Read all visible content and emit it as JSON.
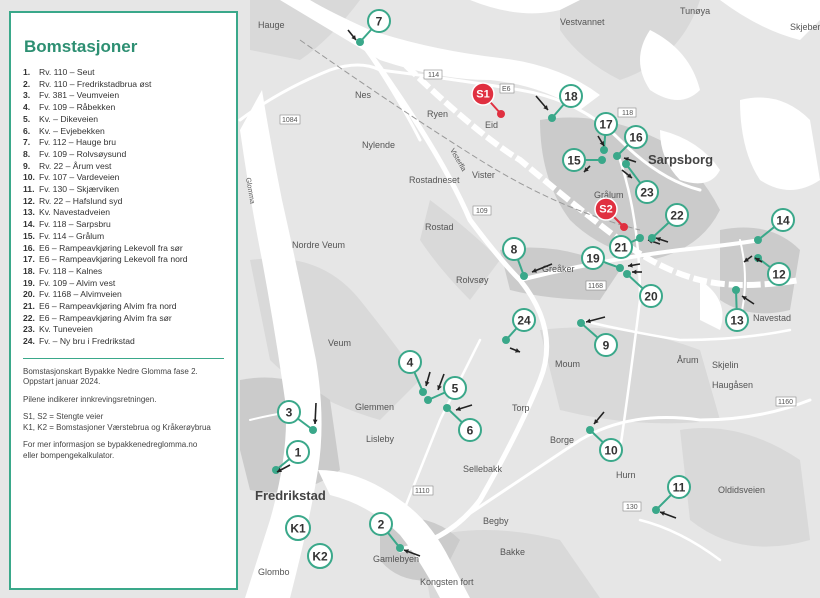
{
  "legend": {
    "title": "Bomstasjoner",
    "items": [
      {
        "num": "1.",
        "label": "Rv. 110 – Seut"
      },
      {
        "num": "2.",
        "label": "Rv. 110 – Fredrikstadbrua øst"
      },
      {
        "num": "3.",
        "label": "Fv. 381 – Veumveien"
      },
      {
        "num": "4.",
        "label": "Fv. 109 – Råbekken"
      },
      {
        "num": "5.",
        "label": "Kv. – Dikeveien"
      },
      {
        "num": "6.",
        "label": "Kv. – Evjebekken"
      },
      {
        "num": "7.",
        "label": "Fv. 112 – Hauge bru"
      },
      {
        "num": "8.",
        "label": "Fv. 109 – Rolvsøysund"
      },
      {
        "num": "9.",
        "label": "Rv. 22 – Årum vest"
      },
      {
        "num": "10.",
        "label": "Fv. 107 – Vardeveien"
      },
      {
        "num": "11.",
        "label": "Fv. 130 – Skjærviken"
      },
      {
        "num": "12.",
        "label": "Rv. 22 – Hafslund syd"
      },
      {
        "num": "13.",
        "label": "Kv. Navestadveien"
      },
      {
        "num": "14.",
        "label": "Fv. 118 – Sarpsbru"
      },
      {
        "num": "15.",
        "label": "Fv. 114 – Grålum"
      },
      {
        "num": "16.",
        "label": "E6 – Rampeavkjøring Lekevoll fra sør"
      },
      {
        "num": "17.",
        "label": "E6 – Rampeavkjøring Lekevoll fra nord"
      },
      {
        "num": "18.",
        "label": "Fv. 118 – Kalnes"
      },
      {
        "num": "19.",
        "label": "Fv. 109 – Alvim vest"
      },
      {
        "num": "20.",
        "label": "Fv. 1168 – Alvimveien"
      },
      {
        "num": "21.",
        "label": "E6 – Rampeavkjøring Alvim fra nord"
      },
      {
        "num": "22.",
        "label": "E6 – Rampeavkjøring Alvim fra sør"
      },
      {
        "num": "23.",
        "label": "Kv. Tuneveien"
      },
      {
        "num": "24.",
        "label": "Fv. – Ny bru i Fredrikstad"
      }
    ],
    "note_1": [
      "Bomstasjonskart Bypakke Nedre Glomma fase 2.",
      "Oppstart januar 2024."
    ],
    "note_2": "Pilene indikerer innkrevingsretningen.",
    "note_3": [
      "S1, S2 = Stengte veier",
      "K1, K2 = Bomstasjoner Værstebrua og Kråkerøybrua"
    ],
    "note_4": [
      "For mer informasjon se bypakkenedreglomma.no",
      "eller bompengekalkulator."
    ]
  },
  "map": {
    "towns": [
      "Sarpsborg",
      "Fredrikstad"
    ],
    "places": [
      "Rolvsøy",
      "Glemmen",
      "Lisleby",
      "Torp",
      "Moum",
      "Borge",
      "Hurn",
      "Årum",
      "Navestad",
      "Skjelin",
      "Haugåsen",
      "Oldidsveien",
      "Greåker",
      "Grålum",
      "Vister",
      "Ryen",
      "Eid",
      "Nes",
      "Nylende",
      "Rostadneset",
      "Rostad",
      "Nordre Veum",
      "Veum",
      "Sellebakk",
      "Begby",
      "Gamlebyen",
      "Kongsten fort",
      "Glombo",
      "Tunøya",
      "Vestvannet",
      "Hauge",
      "Skjeberg",
      "Bakke"
    ],
    "roads": [
      "114",
      "118",
      "1084",
      "E6",
      "1168",
      "109",
      "1160",
      "1110",
      "130",
      "Glomma",
      "Visterfla"
    ],
    "stations": [
      "1",
      "2",
      "3",
      "4",
      "5",
      "6",
      "7",
      "8",
      "9",
      "10",
      "11",
      "12",
      "13",
      "14",
      "15",
      "16",
      "17",
      "18",
      "19",
      "20",
      "21",
      "22",
      "23",
      "24"
    ],
    "extra_stations": [
      "K1",
      "K2"
    ],
    "closed_roads": [
      "S1",
      "S2"
    ],
    "colors": {
      "station": "#3aa88a",
      "closed": "#e03040",
      "water": "#ffffff",
      "land": "#e6e6e6",
      "urban": "#cfcfcf",
      "forest": "#d7d7d7",
      "road": "#ffffff",
      "rail": "#9a9a9a"
    }
  }
}
